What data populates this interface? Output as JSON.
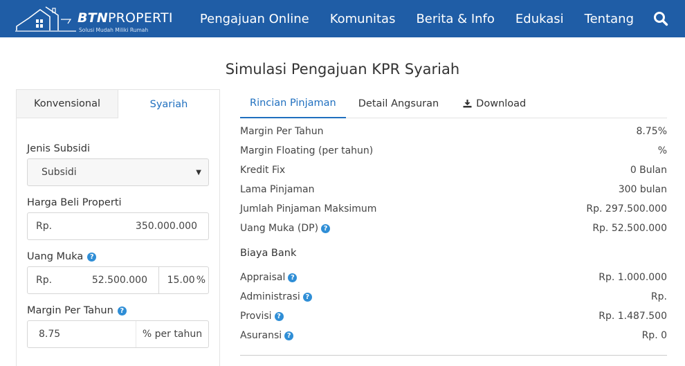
{
  "header": {
    "brand_bold": "BTN",
    "brand_light": "PROPERTI",
    "tagline": "Solusi Mudah Miliki Rumah",
    "nav": [
      "Pengajuan Online",
      "Komunitas",
      "Berita & Info",
      "Edukasi",
      "Tentang"
    ],
    "search_icon": "search-icon"
  },
  "page_title": "Simulasi Pengajuan KPR Syariah",
  "left": {
    "tabs": [
      "Konvensional",
      "Syariah"
    ],
    "active_tab": "Syariah",
    "jenis_subsidi": {
      "label": "Jenis Subsidi",
      "value": "Subsidi"
    },
    "harga_beli": {
      "label": "Harga Beli Properti",
      "prefix": "Rp.",
      "value": "350.000.000"
    },
    "uang_muka": {
      "label": "Uang Muka",
      "prefix": "Rp.",
      "value": "52.500.000",
      "percent": "15.00",
      "percent_suffix": "%"
    },
    "margin": {
      "label": "Margin Per Tahun",
      "value": "8.75",
      "suffix": "% per tahun"
    }
  },
  "right": {
    "tabs": [
      "Rincian Pinjaman",
      "Detail Angsuran",
      "Download"
    ],
    "active_tab": "Rincian Pinjaman",
    "rows": [
      {
        "label": "Margin Per Tahun",
        "value": "8.75%"
      },
      {
        "label": "Margin Floating (per tahun)",
        "value": "%"
      },
      {
        "label": "Kredit Fix",
        "value": "0 Bulan"
      },
      {
        "label": "Lama Pinjaman",
        "value": "300 bulan"
      },
      {
        "label": "Jumlah Pinjaman Maksimum",
        "value": "Rp. 297.500.000"
      },
      {
        "label": "Uang Muka (DP)",
        "value": "Rp. 52.500.000"
      }
    ],
    "biaya_bank_title": "Biaya Bank",
    "biaya_rows": [
      {
        "label": "Appraisal",
        "value": "Rp. 1.000.000"
      },
      {
        "label": "Administrasi",
        "value": "Rp."
      },
      {
        "label": "Provisi",
        "value": "Rp. 1.487.500"
      },
      {
        "label": "Asuransi",
        "value": "Rp. 0"
      }
    ]
  },
  "colors": {
    "header_bg": "#1f5da6",
    "accent": "#1f6fbf",
    "help_icon": "#2f8ed6"
  }
}
